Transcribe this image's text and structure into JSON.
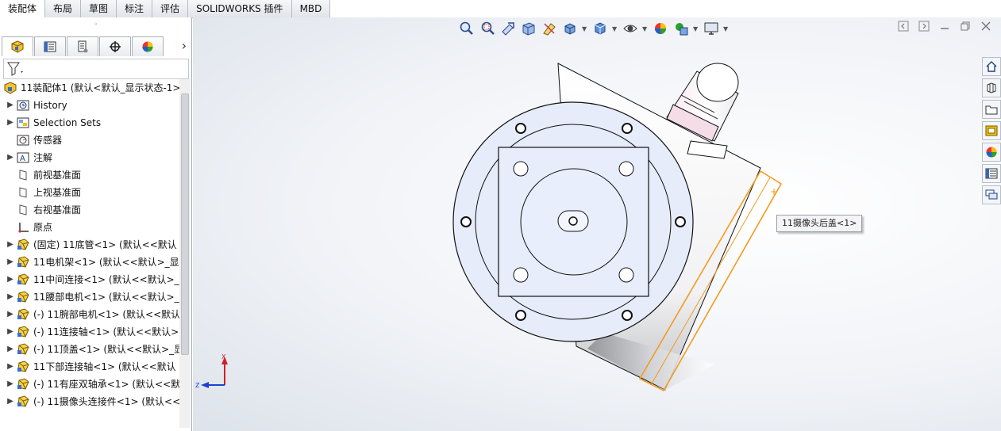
{
  "tabs": [
    {
      "label": "装配体",
      "active": true
    },
    {
      "label": "布局",
      "active": false
    },
    {
      "label": "草图",
      "active": false
    },
    {
      "label": "标注",
      "active": false
    },
    {
      "label": "评估",
      "active": false
    },
    {
      "label": "SOLIDWORKS 插件",
      "active": false
    },
    {
      "label": "MBD",
      "active": false
    }
  ],
  "panel": {
    "grip": "◦",
    "tab_icons": [
      "feature-manager-icon",
      "property-manager-icon",
      "configuration-manager-icon",
      "dimxpert-icon",
      "display-manager-icon"
    ],
    "chevron": "›",
    "filter_icon": "filter-icon"
  },
  "tree": {
    "items": [
      {
        "label": "11装配体1  (默认<默认_显示状态-1>",
        "icon": "assembly-icon",
        "expander": ""
      },
      {
        "label": "History",
        "icon": "history-icon",
        "expander": "▶"
      },
      {
        "label": "Selection Sets",
        "icon": "selection-sets-icon",
        "expander": "▶"
      },
      {
        "label": "传感器",
        "icon": "sensor-icon",
        "expander": ""
      },
      {
        "label": "注解",
        "icon": "annotation-icon",
        "expander": "▶"
      },
      {
        "label": "前视基准面",
        "icon": "plane-icon",
        "expander": ""
      },
      {
        "label": "上视基准面",
        "icon": "plane-icon",
        "expander": ""
      },
      {
        "label": "右视基准面",
        "icon": "plane-icon",
        "expander": ""
      },
      {
        "label": "原点",
        "icon": "origin-icon",
        "expander": ""
      },
      {
        "label": "(固定) 11底管<1> (默认<<默认",
        "icon": "part-icon",
        "expander": "▶"
      },
      {
        "label": "11电机架<1> (默认<<默认>_显",
        "icon": "part-icon",
        "expander": "▶"
      },
      {
        "label": "11中间连接<1> (默认<<默认>_",
        "icon": "part-icon",
        "expander": "▶"
      },
      {
        "label": "11腰部电机<1> (默认<<默认>_",
        "icon": "part-icon",
        "expander": "▶"
      },
      {
        "label": "(-) 11腕部电机<1> (默认<<默认",
        "icon": "part-icon",
        "expander": "▶"
      },
      {
        "label": "(-) 11连接轴<1> (默认<<默认>",
        "icon": "part-icon",
        "expander": "▶"
      },
      {
        "label": "(-) 11顶盖<1> (默认<<默认>_显",
        "icon": "part-icon",
        "expander": "▶"
      },
      {
        "label": "11下部连接轴<1> (默认<<默认",
        "icon": "part-icon",
        "expander": "▶"
      },
      {
        "label": "(-) 11有座双轴承<1> (默认<<默",
        "icon": "part-icon",
        "expander": "▶"
      },
      {
        "label": "(-) 11摄像头连接件<1> (默认<<",
        "icon": "part-icon",
        "expander": "▶"
      }
    ]
  },
  "heads_up_toolbar": {
    "buttons": [
      "zoom-to-fit-icon",
      "zoom-to-area-icon",
      "previous-view-icon",
      "section-view-icon",
      "dynamic-annotation-icon",
      "view-orientation-icon",
      "display-style-icon",
      "hide-show-items-icon",
      "edit-appearance-icon",
      "apply-scene-icon",
      "view-settings-icon"
    ]
  },
  "window_controls": [
    "restore-tile-icon",
    "tile-icon",
    "restore-icon",
    "close-icon"
  ],
  "task_pane": {
    "buttons": [
      "home-icon",
      "design-library-icon",
      "file-explorer-icon",
      "view-palette-icon",
      "appearances-icon",
      "custom-properties-icon",
      "forum-icon"
    ]
  },
  "tooltip": {
    "text": "11摄像头后盖<1>"
  },
  "triad": {
    "x_label": "X",
    "z_label": "Z"
  },
  "colors": {
    "selection": "#f39a1e",
    "axis_y": "#d0202a",
    "axis_z": "#1f3fd0"
  }
}
